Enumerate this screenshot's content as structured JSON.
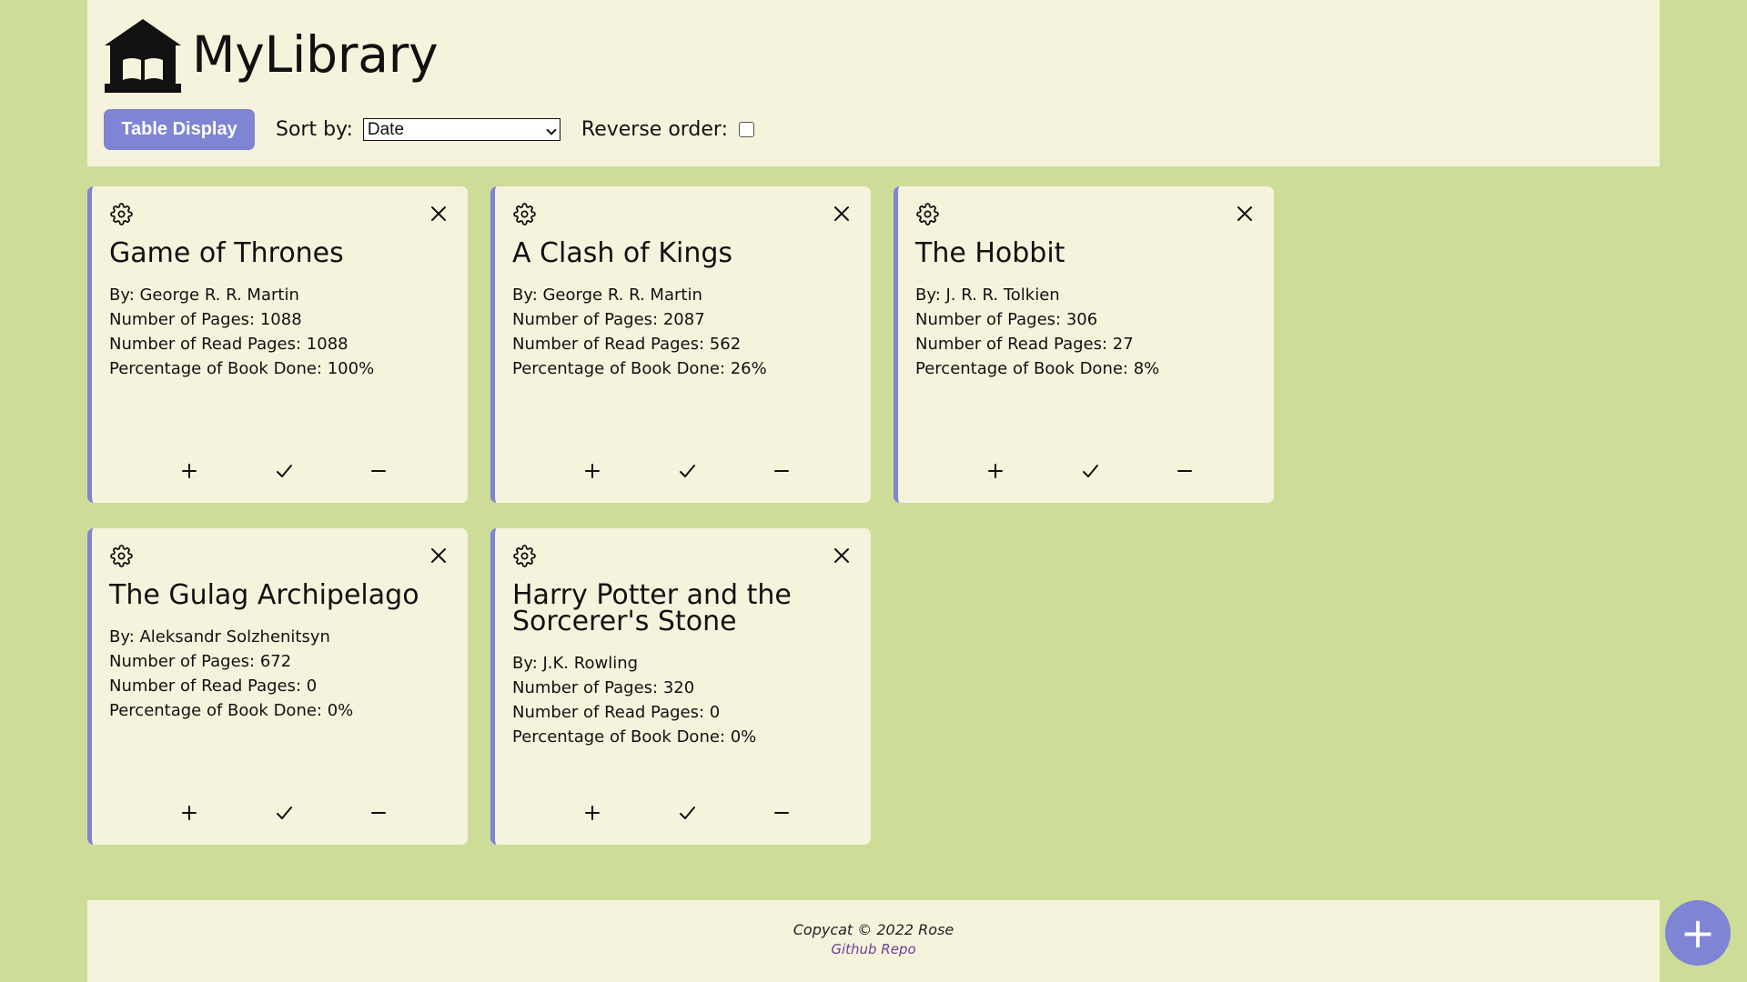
{
  "app": {
    "title": "MyLibrary"
  },
  "controls": {
    "table_display_label": "Table Display",
    "sort_label": "Sort by:",
    "sort_value": "Date",
    "reverse_label": "Reverse order:",
    "reverse_checked": false
  },
  "books": [
    {
      "title": "Game of Thrones",
      "author_line": "By: George R. R. Martin",
      "pages_line": "Number of Pages: 1088",
      "read_line": "Number of Read Pages: 1088",
      "percent_line": "Percentage of Book Done: 100%"
    },
    {
      "title": "A Clash of Kings",
      "author_line": "By: George R. R. Martin",
      "pages_line": "Number of Pages: 2087",
      "read_line": "Number of Read Pages: 562",
      "percent_line": "Percentage of Book Done: 26%"
    },
    {
      "title": "The Hobbit",
      "author_line": "By: J. R. R. Tolkien",
      "pages_line": "Number of Pages: 306",
      "read_line": "Number of Read Pages: 27",
      "percent_line": "Percentage of Book Done: 8%"
    },
    {
      "title": "The Gulag Archipelago",
      "author_line": "By: Aleksandr Solzhenitsyn",
      "pages_line": "Number of Pages: 672",
      "read_line": "Number of Read Pages: 0",
      "percent_line": "Percentage of Book Done: 0%"
    },
    {
      "title": "Harry Potter and the Sorcerer's Stone",
      "author_line": "By: J.K. Rowling",
      "pages_line": "Number of Pages: 320",
      "read_line": "Number of Read Pages: 0",
      "percent_line": "Percentage of Book Done: 0%"
    }
  ],
  "footer": {
    "copyright": "Copycat © 2022 Rose",
    "repo_link": "Github Repo"
  },
  "fab": {
    "label": "+"
  },
  "icons": {
    "library": "library-icon",
    "settings": "gear-icon",
    "close": "close-icon",
    "plus": "plus-icon",
    "check": "check-icon",
    "minus": "minus-icon"
  },
  "colors": {
    "page_bg": "#cddd98",
    "panel_bg": "#f6f3dc",
    "accent": "#7f84d4",
    "link": "#6d3f98"
  }
}
